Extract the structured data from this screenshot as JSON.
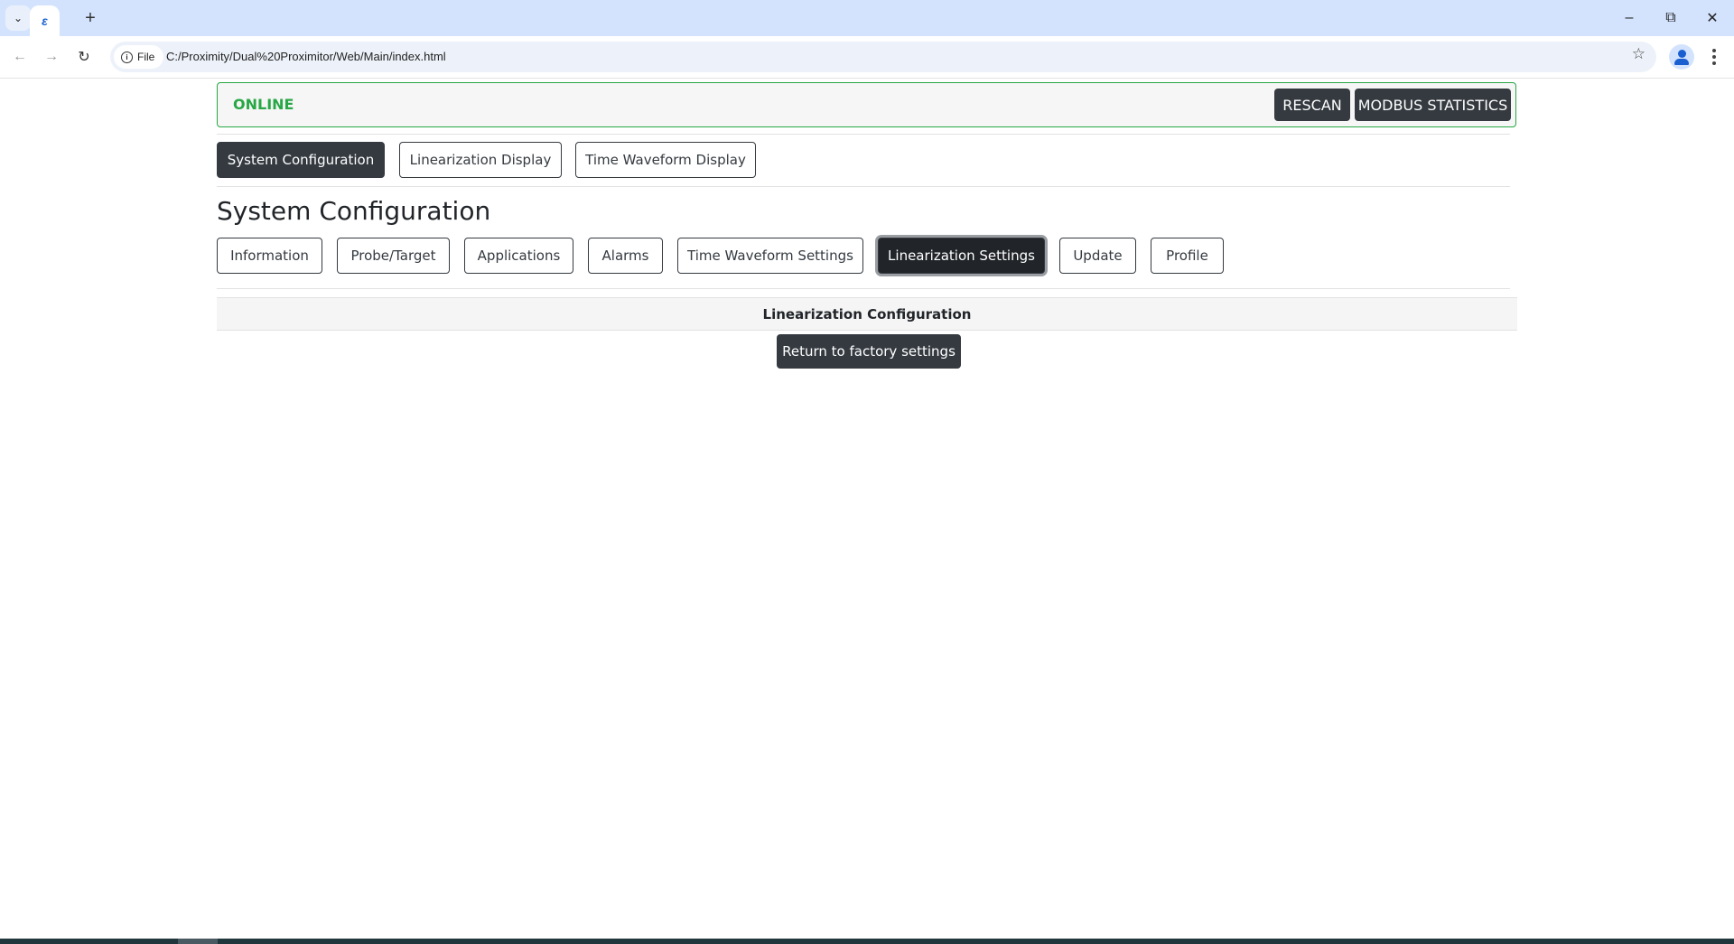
{
  "browser": {
    "tab_icon": "ie-style-favicon",
    "address_chip": "File",
    "url": "C:/Proximity/Dual%20Proximitor/Web/Main/index.html"
  },
  "status": {
    "text": "ONLINE",
    "color": "#28a745",
    "rescan_label": "RESCAN",
    "modbus_label": "MODBUS STATISTICS"
  },
  "nav": {
    "items": [
      {
        "label": "System Configuration",
        "active": true
      },
      {
        "label": "Linearization Display",
        "active": false
      },
      {
        "label": "Time Waveform Display",
        "active": false
      }
    ]
  },
  "section": {
    "title": "System Configuration",
    "tabs": [
      {
        "label": "Information"
      },
      {
        "label": "Probe/Target"
      },
      {
        "label": "Applications"
      },
      {
        "label": "Alarms"
      },
      {
        "label": "Time Waveform Settings"
      },
      {
        "label": "Linearization Settings",
        "active": true
      },
      {
        "label": "Update"
      },
      {
        "label": "Profile"
      }
    ]
  },
  "linearization": {
    "header": "Linearization Configuration",
    "factory_button": "Return to factory settings"
  }
}
